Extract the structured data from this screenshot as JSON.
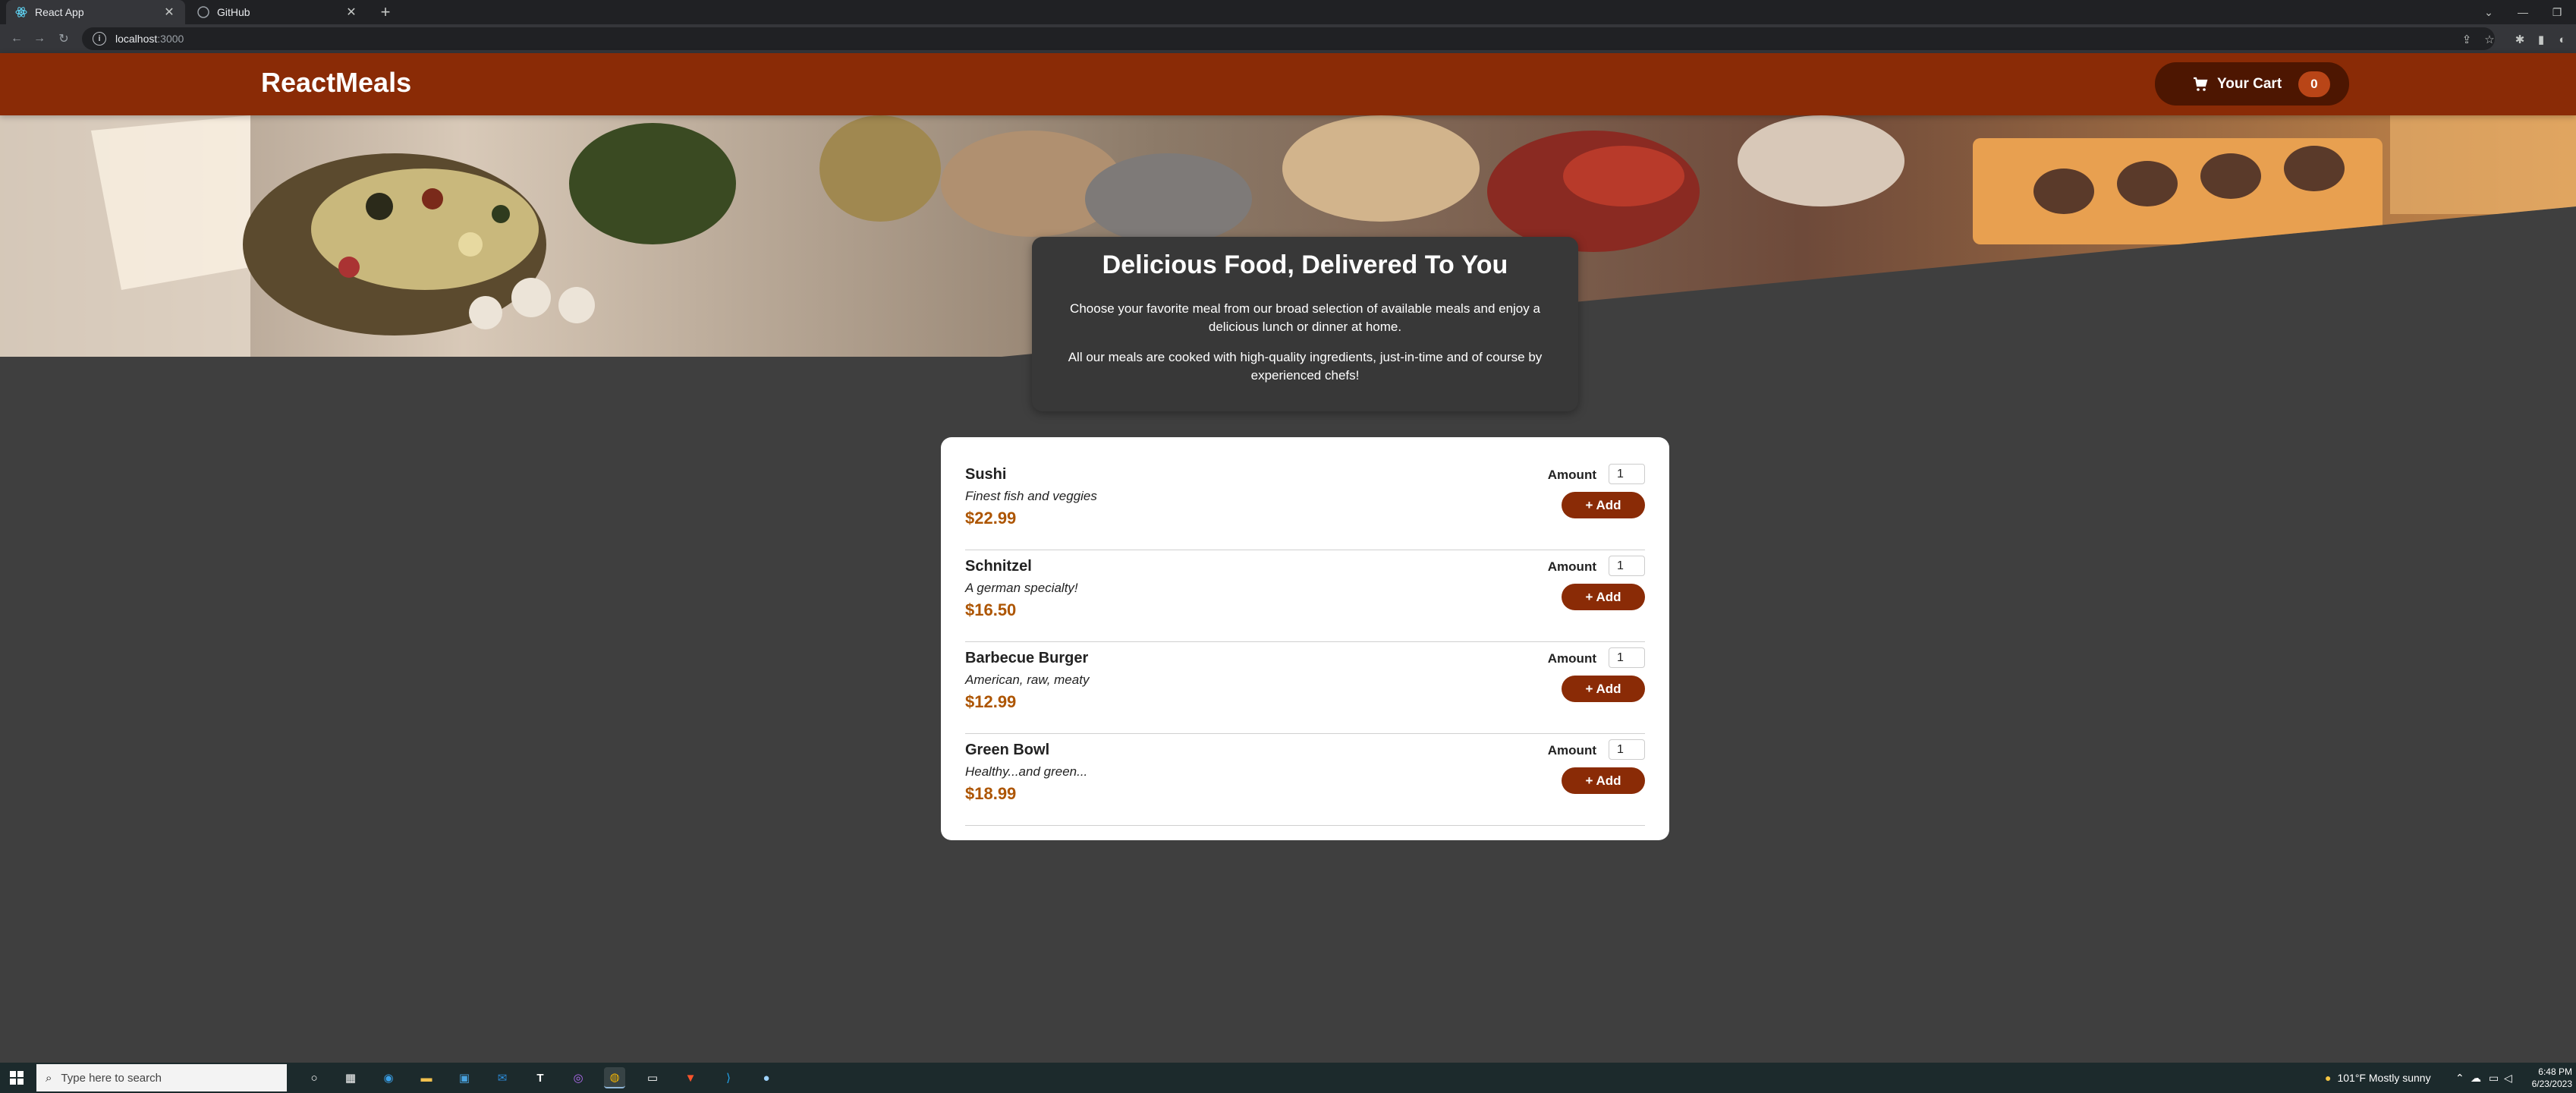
{
  "browser": {
    "tabs": [
      {
        "title": "React App",
        "active": true
      },
      {
        "title": "GitHub",
        "active": false
      }
    ],
    "url_host": "localhost",
    "url_port": ":3000"
  },
  "header": {
    "brand": "ReactMeals",
    "cart_label": "Your Cart",
    "cart_count": "0"
  },
  "summary": {
    "title": "Delicious Food, Delivered To You",
    "paragraph1": "Choose your favorite meal from our broad selection of available meals and enjoy a delicious lunch or dinner at home.",
    "paragraph2": "All our meals are cooked with high-quality ingredients, just-in-time and of course by experienced chefs!"
  },
  "meals": [
    {
      "name": "Sushi",
      "description": "Finest fish and veggies",
      "price": "$22.99",
      "amount_label": "Amount",
      "amount": "1",
      "add_label": "+ Add"
    },
    {
      "name": "Schnitzel",
      "description": "A german specialty!",
      "price": "$16.50",
      "amount_label": "Amount",
      "amount": "1",
      "add_label": "+ Add"
    },
    {
      "name": "Barbecue Burger",
      "description": "American, raw, meaty",
      "price": "$12.99",
      "amount_label": "Amount",
      "amount": "1",
      "add_label": "+ Add"
    },
    {
      "name": "Green Bowl",
      "description": "Healthy...and green...",
      "price": "$18.99",
      "amount_label": "Amount",
      "amount": "1",
      "add_label": "+ Add"
    }
  ],
  "taskbar": {
    "search_placeholder": "Type here to search",
    "weather": "101°F  Mostly sunny",
    "time": "6:48 PM",
    "date": "6/23/2023"
  },
  "colors": {
    "header": "#8a2b06",
    "cart_button": "#4d1601",
    "badge": "#b94517",
    "price": "#ad5502",
    "page_bg": "#3f3f3f"
  }
}
